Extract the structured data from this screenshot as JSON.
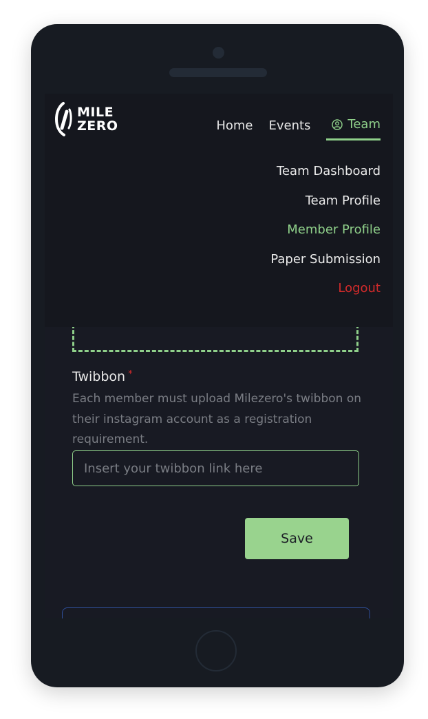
{
  "brand": {
    "line1": "MILE",
    "line2": "ZERO"
  },
  "nav": {
    "home": "Home",
    "events": "Events",
    "team": "Team"
  },
  "dropdown": {
    "items": [
      {
        "label": "Team Dashboard"
      },
      {
        "label": "Team Profile"
      },
      {
        "label": "Member Profile"
      },
      {
        "label": "Paper Submission"
      },
      {
        "label": "Logout"
      }
    ]
  },
  "form": {
    "twibbon_label": "Twibbon",
    "required_mark": "*",
    "twibbon_help": "Each member must upload Milezero's twibbon on their instagram account as a registration requirement.",
    "twibbon_placeholder": "Insert your twibbon link here",
    "twibbon_value": "",
    "save_label": "Save"
  },
  "colors": {
    "accent": "#8fd08a",
    "button": "#99d38e",
    "danger": "#d42b2b",
    "background": "#181a23"
  },
  "icons": {
    "user": "user-circle-icon",
    "logo": "milezero-logo-mark"
  }
}
